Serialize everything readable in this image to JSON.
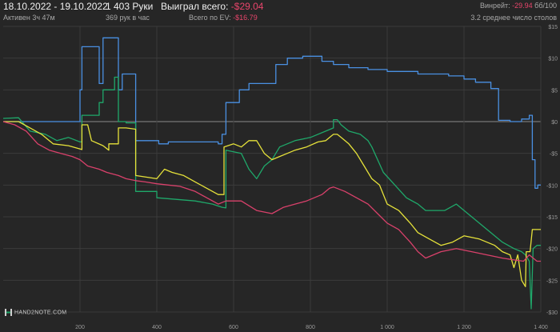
{
  "header": {
    "date_range": "18.10.2022 - 19.10.2022",
    "active_time": "Активен 3ч 47м",
    "hands": "1 403 Руки",
    "hands_per_hour": "369 рук в час",
    "won_label": "Выиграл всего:",
    "won_value": "-$29.04",
    "ev_label": "Всего по EV:",
    "ev_value": "-$16.79",
    "winrate_label": "Винрейт:",
    "winrate_value": "-29.94",
    "winrate_unit": "бб/100",
    "avg_tables": "3.2 среднее число столов"
  },
  "logo": {
    "text": "HAND2NOTE.COM",
    "icon": "hand2note-logo-icon"
  },
  "colors": {
    "background": "#262626",
    "grid": "#3b3b3b",
    "zero_line": "#8a8a8a",
    "blue": "#4a90e2",
    "green": "#1fa86a",
    "yellow": "#e6e23a",
    "red": "#d9416b"
  },
  "chart_data": {
    "type": "line",
    "x_tick_labels": [
      "200",
      "400",
      "600",
      "800",
      "1 000",
      "1 200",
      "1 400"
    ],
    "y_tick_labels": [
      "$15",
      "$10",
      "$5",
      "$0",
      "-$5",
      "-$10",
      "-$15",
      "-$20",
      "-$25",
      "-$30"
    ],
    "xlim": [
      0,
      1400
    ],
    "ylim": [
      -30,
      15
    ],
    "grid": true,
    "legend": "none",
    "series": [
      {
        "color": "blue",
        "points": [
          [
            0,
            0
          ],
          [
            200,
            0
          ],
          [
            200,
            5
          ],
          [
            205,
            5
          ],
          [
            205,
            11.8
          ],
          [
            250,
            11.8
          ],
          [
            250,
            6
          ],
          [
            260,
            6
          ],
          [
            260,
            13.2
          ],
          [
            300,
            13.2
          ],
          [
            300,
            5
          ],
          [
            310,
            5
          ],
          [
            310,
            7.5
          ],
          [
            345,
            7.5
          ],
          [
            345,
            -3
          ],
          [
            405,
            -3
          ],
          [
            405,
            -3.5
          ],
          [
            430,
            -3.5
          ],
          [
            430,
            -3.2
          ],
          [
            560,
            -3.2
          ],
          [
            560,
            -3.5
          ],
          [
            570,
            -3.5
          ],
          [
            570,
            -2
          ],
          [
            580,
            -2
          ],
          [
            580,
            3
          ],
          [
            615,
            3
          ],
          [
            615,
            5
          ],
          [
            640,
            5
          ],
          [
            640,
            6
          ],
          [
            710,
            6
          ],
          [
            710,
            9
          ],
          [
            740,
            9
          ],
          [
            740,
            10
          ],
          [
            780,
            10
          ],
          [
            780,
            10.3
          ],
          [
            830,
            10.3
          ],
          [
            830,
            9.5
          ],
          [
            860,
            9.5
          ],
          [
            860,
            9
          ],
          [
            900,
            9
          ],
          [
            900,
            8.5
          ],
          [
            950,
            8.5
          ],
          [
            950,
            8.2
          ],
          [
            1000,
            8.2
          ],
          [
            1000,
            7.9
          ],
          [
            1080,
            7.9
          ],
          [
            1080,
            7.5
          ],
          [
            1160,
            7.5
          ],
          [
            1160,
            7.2
          ],
          [
            1200,
            7.2
          ],
          [
            1200,
            6.7
          ],
          [
            1230,
            6.7
          ],
          [
            1230,
            6.2
          ],
          [
            1270,
            6.2
          ],
          [
            1270,
            5.2
          ],
          [
            1290,
            5.2
          ],
          [
            1290,
            0.2
          ],
          [
            1320,
            0.2
          ],
          [
            1320,
            0
          ],
          [
            1350,
            0
          ],
          [
            1350,
            0.4
          ],
          [
            1370,
            0.4
          ],
          [
            1370,
            1
          ],
          [
            1378,
            1
          ],
          [
            1378,
            -6
          ],
          [
            1385,
            -6
          ],
          [
            1385,
            -10.5
          ],
          [
            1392,
            -10.5
          ],
          [
            1392,
            -10
          ],
          [
            1400,
            -10
          ]
        ]
      },
      {
        "color": "green",
        "points": [
          [
            0,
            0.5
          ],
          [
            40,
            0.6
          ],
          [
            70,
            -1.5
          ],
          [
            110,
            -2
          ],
          [
            140,
            -3
          ],
          [
            170,
            -2.5
          ],
          [
            200,
            -3.2
          ],
          [
            205,
            -3.2
          ],
          [
            205,
            1
          ],
          [
            250,
            1
          ],
          [
            250,
            3
          ],
          [
            260,
            3
          ],
          [
            260,
            5
          ],
          [
            290,
            5
          ],
          [
            290,
            7
          ],
          [
            300,
            7
          ],
          [
            300,
            0
          ],
          [
            320,
            0
          ],
          [
            320,
            -0.2
          ],
          [
            345,
            -0.2
          ],
          [
            345,
            -11
          ],
          [
            400,
            -11
          ],
          [
            400,
            -12
          ],
          [
            500,
            -12.5
          ],
          [
            545,
            -13
          ],
          [
            570,
            -13.5
          ],
          [
            580,
            -13.6
          ],
          [
            580,
            -4.5
          ],
          [
            620,
            -5
          ],
          [
            640,
            -7.5
          ],
          [
            660,
            -9
          ],
          [
            680,
            -7
          ],
          [
            700,
            -6
          ],
          [
            720,
            -4
          ],
          [
            760,
            -3
          ],
          [
            800,
            -2.5
          ],
          [
            840,
            -1.5
          ],
          [
            860,
            -1
          ],
          [
            860,
            0.3
          ],
          [
            870,
            0.3
          ],
          [
            880,
            -0.5
          ],
          [
            900,
            -1.5
          ],
          [
            930,
            -2
          ],
          [
            950,
            -3
          ],
          [
            960,
            -4
          ],
          [
            990,
            -8
          ],
          [
            1020,
            -10
          ],
          [
            1050,
            -12
          ],
          [
            1080,
            -13
          ],
          [
            1100,
            -14
          ],
          [
            1150,
            -14
          ],
          [
            1180,
            -13
          ],
          [
            1220,
            -15
          ],
          [
            1260,
            -17
          ],
          [
            1300,
            -19
          ],
          [
            1330,
            -20
          ],
          [
            1350,
            -20.5
          ],
          [
            1360,
            -21
          ],
          [
            1370,
            -22
          ],
          [
            1375,
            -29.5
          ],
          [
            1380,
            -20
          ],
          [
            1390,
            -19.5
          ],
          [
            1400,
            -19.5
          ]
        ]
      },
      {
        "color": "yellow",
        "points": [
          [
            0,
            0
          ],
          [
            40,
            0
          ],
          [
            70,
            -1
          ],
          [
            100,
            -2
          ],
          [
            130,
            -3.5
          ],
          [
            170,
            -3.8
          ],
          [
            205,
            -4.4
          ],
          [
            205,
            -0.5
          ],
          [
            220,
            -0.5
          ],
          [
            230,
            -3
          ],
          [
            260,
            -3.8
          ],
          [
            275,
            -4.5
          ],
          [
            275,
            -3.5
          ],
          [
            300,
            -3.5
          ],
          [
            300,
            -1
          ],
          [
            320,
            -1
          ],
          [
            345,
            -1.2
          ],
          [
            345,
            -8.5
          ],
          [
            400,
            -9
          ],
          [
            420,
            -7.5
          ],
          [
            440,
            -8
          ],
          [
            470,
            -8.5
          ],
          [
            500,
            -9.5
          ],
          [
            530,
            -10.5
          ],
          [
            560,
            -11.5
          ],
          [
            575,
            -11.5
          ],
          [
            575,
            -4
          ],
          [
            600,
            -3.5
          ],
          [
            620,
            -4
          ],
          [
            640,
            -3
          ],
          [
            660,
            -3
          ],
          [
            680,
            -5
          ],
          [
            700,
            -6
          ],
          [
            720,
            -5.5
          ],
          [
            740,
            -5
          ],
          [
            760,
            -4.5
          ],
          [
            790,
            -4
          ],
          [
            820,
            -3.2
          ],
          [
            840,
            -3
          ],
          [
            850,
            -2.5
          ],
          [
            860,
            -2
          ],
          [
            870,
            -2
          ],
          [
            880,
            -2.5
          ],
          [
            900,
            -3.5
          ],
          [
            920,
            -5
          ],
          [
            940,
            -7
          ],
          [
            960,
            -9
          ],
          [
            980,
            -10
          ],
          [
            1000,
            -13
          ],
          [
            1030,
            -14
          ],
          [
            1060,
            -16
          ],
          [
            1080,
            -17.5
          ],
          [
            1110,
            -18.5
          ],
          [
            1140,
            -19.5
          ],
          [
            1170,
            -19
          ],
          [
            1200,
            -18
          ],
          [
            1240,
            -18.5
          ],
          [
            1280,
            -19.5
          ],
          [
            1300,
            -20.5
          ],
          [
            1320,
            -21
          ],
          [
            1330,
            -23
          ],
          [
            1340,
            -21
          ],
          [
            1350,
            -25
          ],
          [
            1360,
            -26
          ],
          [
            1362,
            -20.5
          ],
          [
            1372,
            -20.5
          ],
          [
            1378,
            -17
          ],
          [
            1392,
            -17
          ],
          [
            1400,
            -17
          ]
        ]
      },
      {
        "color": "red",
        "points": [
          [
            0,
            0
          ],
          [
            30,
            -0.5
          ],
          [
            60,
            -1.5
          ],
          [
            90,
            -3.5
          ],
          [
            120,
            -4.5
          ],
          [
            150,
            -5
          ],
          [
            180,
            -5.5
          ],
          [
            200,
            -6
          ],
          [
            220,
            -7
          ],
          [
            250,
            -7.5
          ],
          [
            270,
            -8
          ],
          [
            300,
            -8.5
          ],
          [
            320,
            -9
          ],
          [
            345,
            -9.3
          ],
          [
            370,
            -9.5
          ],
          [
            400,
            -9.8
          ],
          [
            430,
            -10
          ],
          [
            460,
            -10.2
          ],
          [
            500,
            -11
          ],
          [
            530,
            -12
          ],
          [
            560,
            -13
          ],
          [
            580,
            -12.5
          ],
          [
            620,
            -12.5
          ],
          [
            660,
            -14
          ],
          [
            700,
            -14.5
          ],
          [
            730,
            -13.5
          ],
          [
            760,
            -13
          ],
          [
            790,
            -12.5
          ],
          [
            810,
            -12
          ],
          [
            830,
            -11.5
          ],
          [
            850,
            -10.5
          ],
          [
            860,
            -10.3
          ],
          [
            890,
            -11
          ],
          [
            920,
            -12
          ],
          [
            950,
            -13
          ],
          [
            975,
            -14.5
          ],
          [
            1000,
            -16
          ],
          [
            1030,
            -17
          ],
          [
            1060,
            -19
          ],
          [
            1080,
            -20.5
          ],
          [
            1100,
            -21.5
          ],
          [
            1140,
            -20.5
          ],
          [
            1180,
            -20
          ],
          [
            1220,
            -20.5
          ],
          [
            1260,
            -21
          ],
          [
            1300,
            -21.5
          ],
          [
            1330,
            -21.8
          ],
          [
            1355,
            -22
          ],
          [
            1370,
            -21
          ],
          [
            1390,
            -22
          ],
          [
            1400,
            -22
          ]
        ]
      }
    ]
  }
}
